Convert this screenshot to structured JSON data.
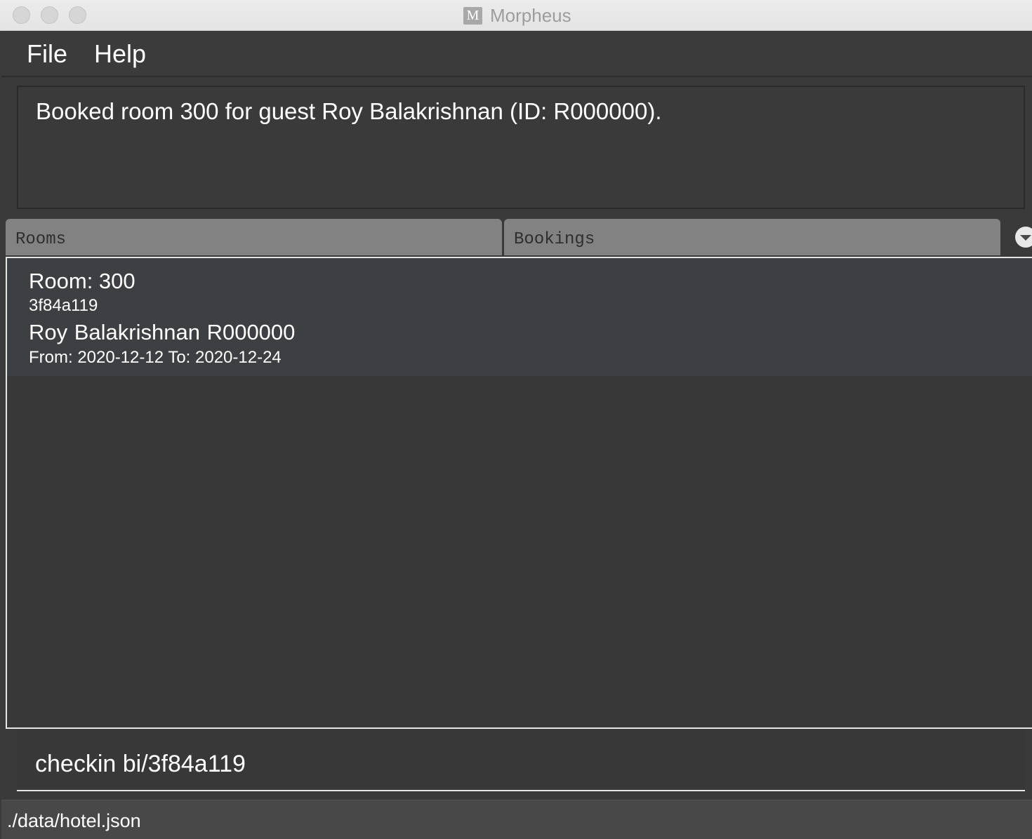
{
  "window": {
    "title": "Morpheus",
    "app_icon_letter": "M"
  },
  "menu": {
    "file": "File",
    "help": "Help"
  },
  "result": {
    "message": "Booked room 300 for guest Roy Balakrishnan (ID: R000000)."
  },
  "tabs": [
    {
      "label": "Rooms",
      "selected": false
    },
    {
      "label": "Bookings",
      "selected": false
    }
  ],
  "bookings": [
    {
      "room": "Room: 300",
      "booking_id": "3f84a119",
      "guest": "Roy Balakrishnan  R000000",
      "dates": "From: 2020-12-12 To: 2020-12-24"
    }
  ],
  "command": {
    "value": "checkin bi/3f84a119"
  },
  "status": {
    "file_path": "./data/hotel.json"
  },
  "icons": {
    "tab_dropdown": "chevron-down-icon"
  }
}
